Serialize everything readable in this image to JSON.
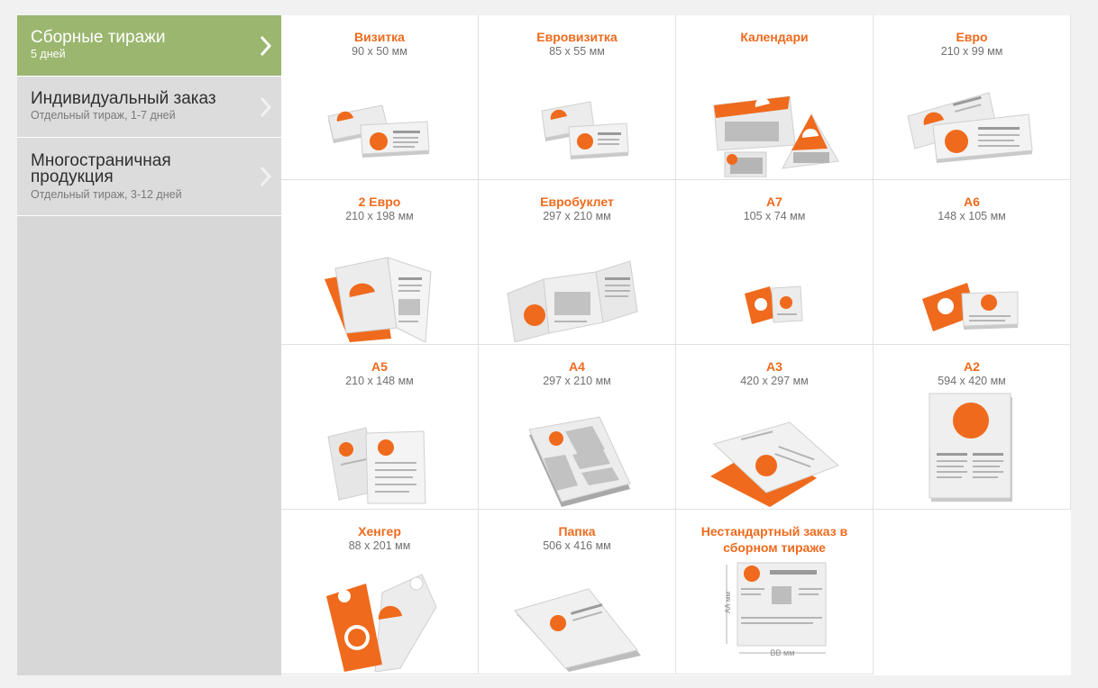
{
  "sidebar": {
    "items": [
      {
        "title": "Сборные тиражи",
        "subtitle": "5 дней",
        "active": true
      },
      {
        "title": "Индивидуальный заказ",
        "subtitle": "Отдельный тираж, 1-7 дней",
        "active": false
      },
      {
        "title": "Многостраничная продукция",
        "subtitle": "Отдельный тираж, 3-12 дней",
        "active": false
      }
    ]
  },
  "products": [
    {
      "name": "Визитка",
      "size": "90 x 50 мм",
      "icon": "business-card-icon"
    },
    {
      "name": "Евровизитка",
      "size": "85 x 55 мм",
      "icon": "euro-business-card-icon"
    },
    {
      "name": "Календари",
      "size": "",
      "icon": "calendar-icon"
    },
    {
      "name": "Евро",
      "size": "210 x 99 мм",
      "icon": "euro-flyer-icon"
    },
    {
      "name": "2 Евро",
      "size": "210 x 198 мм",
      "icon": "two-euro-booklet-icon"
    },
    {
      "name": "Евробуклет",
      "size": "297 x 210 мм",
      "icon": "eurobooklet-icon"
    },
    {
      "name": "А7",
      "size": "105 x 74 мм",
      "icon": "a7-flyer-icon"
    },
    {
      "name": "А6",
      "size": "148 x 105 мм",
      "icon": "a6-flyer-icon"
    },
    {
      "name": "А5",
      "size": "210 x 148 мм",
      "icon": "a5-flyer-icon"
    },
    {
      "name": "А4",
      "size": "297 x 210 мм",
      "icon": "a4-flyer-icon"
    },
    {
      "name": "А3",
      "size": "420 x 297 мм",
      "icon": "a3-poster-icon"
    },
    {
      "name": "А2",
      "size": "594 x 420 мм",
      "icon": "a2-poster-icon"
    },
    {
      "name": "Хенгер",
      "size": "88 x 201 мм",
      "icon": "door-hanger-icon"
    },
    {
      "name": "Папка",
      "size": "506 x 416 мм",
      "icon": "folder-icon"
    },
    {
      "name": "Нестандартный заказ в сборном тираже",
      "size": "",
      "icon": "custom-order-icon",
      "dim_vertical": "АА мм",
      "dim_horizontal": "ВВ мм"
    }
  ],
  "colors": {
    "accent": "#ef6a1c",
    "sidebar_active": "#9bb66f",
    "sidebar_inactive": "#dcdcdc"
  }
}
